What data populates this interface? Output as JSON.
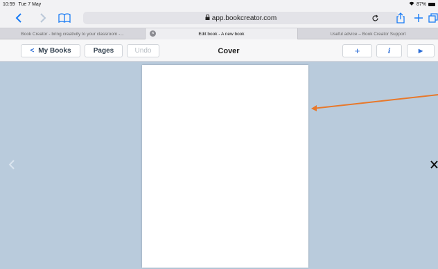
{
  "status": {
    "time": "10:59",
    "date": "Tue 7 May",
    "battery": "87%"
  },
  "browser": {
    "url": "app.bookcreator.com",
    "tabs": [
      {
        "label": "Book Creator - bring creativity to your classroom -...",
        "active": false
      },
      {
        "label": "Edit book - A new book",
        "active": true
      },
      {
        "label": "Useful advice – Book Creator Support",
        "active": false
      }
    ]
  },
  "appbar": {
    "my_books": "My Books",
    "pages": "Pages",
    "undo": "Undo",
    "title": "Cover",
    "add": "+",
    "info": "i",
    "play": "▶"
  },
  "icons": {
    "back": "chevron-left-icon",
    "forward": "chevron-right-icon",
    "bookmarks": "book-icon",
    "lock": "lock-icon",
    "reload": "reload-icon",
    "share": "share-icon",
    "new_tab": "plus-icon",
    "tabs": "tabs-icon",
    "prev_page": "chevron-left-icon",
    "next_page": "close-icon"
  },
  "colors": {
    "accent": "#1a7cf5",
    "app_blue": "#2a6cd6",
    "canvas": "#b9cbdc",
    "annotation_arrow": "#e8782a",
    "frame": "#9edff0"
  }
}
